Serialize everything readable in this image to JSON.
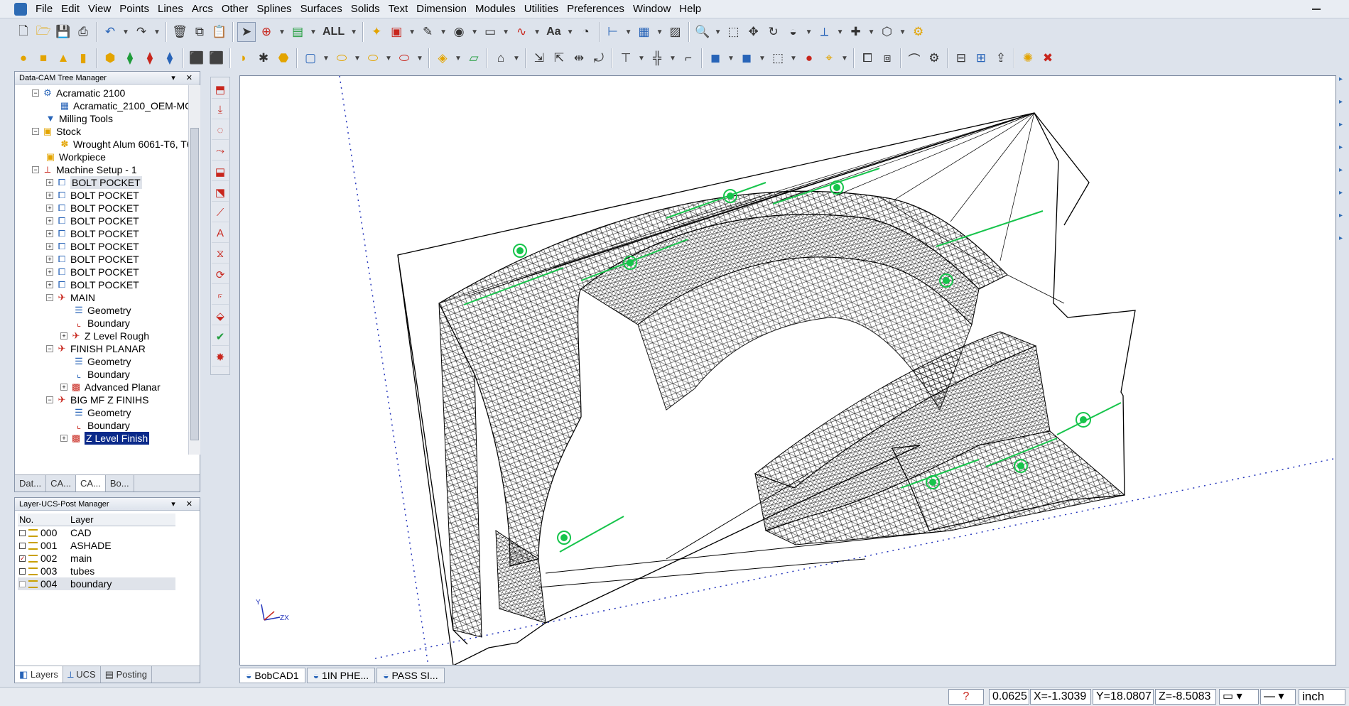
{
  "menu": [
    "File",
    "Edit",
    "View",
    "Points",
    "Lines",
    "Arcs",
    "Other",
    "Splines",
    "Surfaces",
    "Solids",
    "Text",
    "Dimension",
    "Modules",
    "Utilities",
    "Preferences",
    "Window",
    "Help"
  ],
  "toolbar": {
    "all_label": "ALL",
    "text_tool_label": "Aa"
  },
  "tree": {
    "title": "Data-CAM Tree Manager",
    "nodes": [
      {
        "label": "Acramatic 2100"
      },
      {
        "label": "Acramatic_2100_OEM-MO"
      },
      {
        "label": "Milling Tools"
      },
      {
        "label": "Stock"
      },
      {
        "label": "Wrought Alum 6061-T6, T6"
      },
      {
        "label": "Workpiece"
      },
      {
        "label": "Machine Setup - 1"
      },
      {
        "label": "BOLT POCKET"
      },
      {
        "label": "BOLT POCKET"
      },
      {
        "label": "BOLT POCKET"
      },
      {
        "label": "BOLT POCKET"
      },
      {
        "label": "BOLT POCKET"
      },
      {
        "label": "BOLT POCKET"
      },
      {
        "label": "BOLT POCKET"
      },
      {
        "label": "BOLT POCKET"
      },
      {
        "label": "BOLT POCKET"
      },
      {
        "label": "MAIN"
      },
      {
        "label": "Geometry"
      },
      {
        "label": "Boundary"
      },
      {
        "label": "Z Level Rough"
      },
      {
        "label": "FINISH PLANAR"
      },
      {
        "label": "Geometry"
      },
      {
        "label": "Boundary"
      },
      {
        "label": "Advanced Planar"
      },
      {
        "label": "BIG MF Z FINIHS"
      },
      {
        "label": "Geometry"
      },
      {
        "label": "Boundary"
      },
      {
        "label": "Z Level Finish"
      }
    ],
    "tabs": [
      "Dat...",
      "CA...",
      "CA...",
      "Bo..."
    ]
  },
  "layers": {
    "title": "Layer-UCS-Post Manager",
    "columns": [
      "No.",
      "Layer"
    ],
    "rows": [
      {
        "no": "000",
        "name": "CAD",
        "checked": false
      },
      {
        "no": "001",
        "name": "ASHADE",
        "checked": false
      },
      {
        "no": "002",
        "name": "main",
        "checked": true
      },
      {
        "no": "003",
        "name": "tubes",
        "checked": false
      },
      {
        "no": "004",
        "name": "boundary",
        "checked": false
      }
    ],
    "tabs": [
      "Layers",
      "UCS",
      "Posting"
    ]
  },
  "viewport_tabs": [
    "BobCAD1",
    "1IN PHE...",
    "PASS SI..."
  ],
  "axis_labels": {
    "y": "Y",
    "zx": "ZX"
  },
  "status": {
    "step": "0.0625",
    "x": "X=-1.3039",
    "y": "Y=18.0807",
    "z": "Z=-8.5083",
    "units": "inch"
  }
}
